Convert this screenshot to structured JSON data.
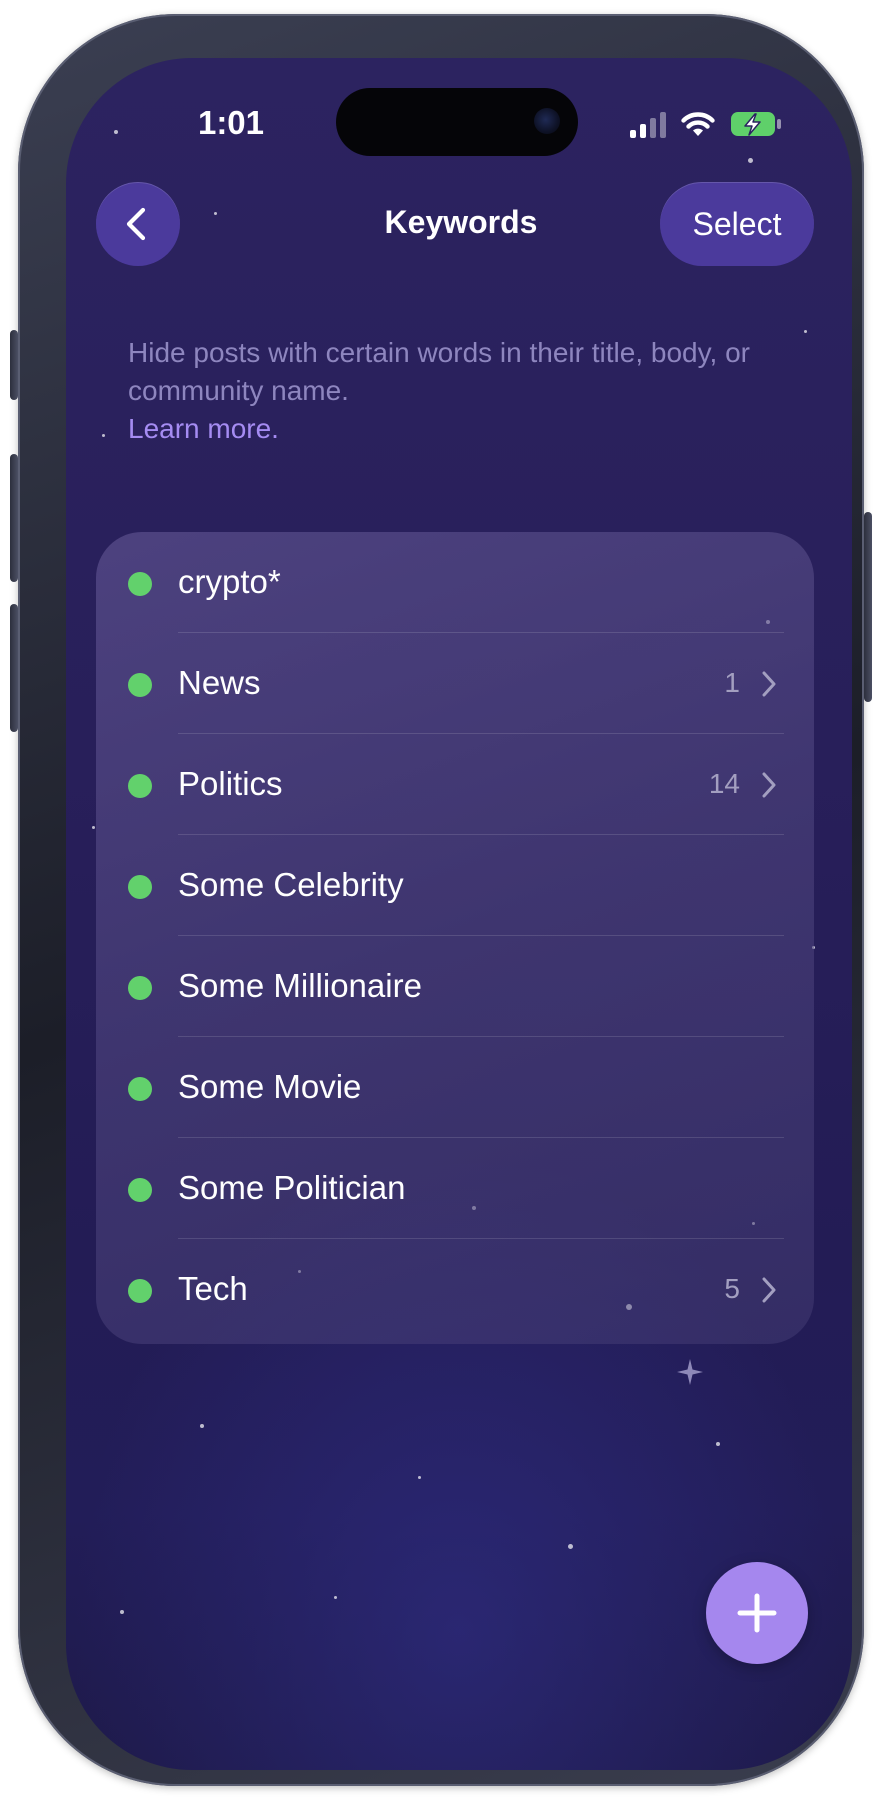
{
  "status_bar": {
    "time": "1:01"
  },
  "nav": {
    "title": "Keywords",
    "select_label": "Select",
    "back_icon": "chevron-left-icon"
  },
  "description": {
    "text": "Hide posts with certain words in their title, body, or community name.",
    "link": "Learn more."
  },
  "keywords": [
    {
      "label": "crypto*",
      "count": ""
    },
    {
      "label": "News",
      "count": "1"
    },
    {
      "label": "Politics",
      "count": "14"
    },
    {
      "label": "Some Celebrity",
      "count": ""
    },
    {
      "label": "Some Millionaire",
      "count": ""
    },
    {
      "label": "Some Movie",
      "count": ""
    },
    {
      "label": "Some Politician",
      "count": ""
    },
    {
      "label": "Tech",
      "count": "5"
    }
  ],
  "fab": {
    "icon": "plus-icon"
  },
  "colors": {
    "background": "#261e58",
    "button": "#4b3a9c",
    "accent": "#a587ee",
    "link": "#a58cf2",
    "active_dot": "#62d16c"
  }
}
